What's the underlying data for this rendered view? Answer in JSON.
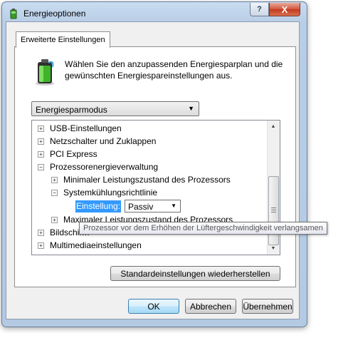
{
  "window": {
    "title": "Energieoptionen",
    "help_label": "?",
    "close_label": "X"
  },
  "tab": {
    "label": "Erweiterte Einstellungen"
  },
  "description": "Wählen Sie den anzupassenden Energiesparplan und die gewünschten Energiespareinstellungen aus.",
  "plan_select": {
    "value": "Energiesparmodus"
  },
  "tree": {
    "items": [
      {
        "label": "USB-Einstellungen",
        "expander": "+"
      },
      {
        "label": "Netzschalter und Zuklappen",
        "expander": "+"
      },
      {
        "label": "PCI Express",
        "expander": "+"
      },
      {
        "label": "Prozessorenergieverwaltung",
        "expander": "−"
      },
      {
        "label": "Minimaler Leistungszustand des Prozessors",
        "expander": "+"
      },
      {
        "label": "Systemkühlungsrichtlinie",
        "expander": "−"
      },
      {
        "label": "Maximaler Leistungszustand des Prozessors",
        "expander": "+"
      },
      {
        "label": "Bildschirm",
        "expander": "+"
      },
      {
        "label": "Multimediaeinstellungen",
        "expander": "+"
      }
    ],
    "setting_label": "Einstellung:",
    "setting_value": "Passiv"
  },
  "tooltip": "Prozessor vor dem Erhöhen der Lüftergeschwindigkeit verlangsamen",
  "buttons": {
    "restore": "Standardeinstellungen wiederherstellen",
    "ok": "OK",
    "cancel": "Abbrechen",
    "apply": "Übernehmen"
  },
  "colors": {
    "selection": "#3399ff",
    "title_bar": "#b9d1ea"
  }
}
